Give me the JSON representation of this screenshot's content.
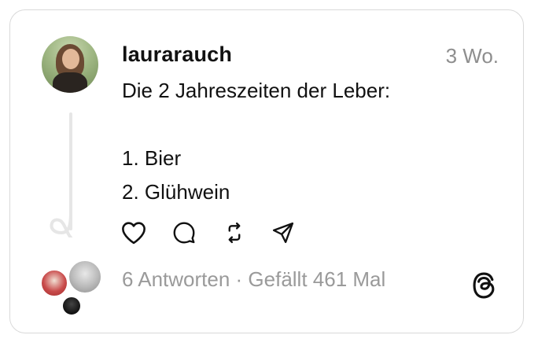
{
  "post": {
    "username": "laurarauch",
    "time": "3 Wo.",
    "text": "Die 2 Jahreszeiten der Leber:\n\n1. Bier\n2. Glühwein"
  },
  "actions": [
    {
      "name": "like",
      "icon": "heart-icon"
    },
    {
      "name": "comment",
      "icon": "comment-icon"
    },
    {
      "name": "repost",
      "icon": "repost-icon"
    },
    {
      "name": "share",
      "icon": "send-icon"
    }
  ],
  "footer": {
    "stats": "6 Antworten · Gefällt 461 Mal",
    "logo_icon": "threads-logo-icon"
  },
  "colors": {
    "text": "#111111",
    "muted": "#8e8e8e",
    "border": "#d9d9d9"
  }
}
